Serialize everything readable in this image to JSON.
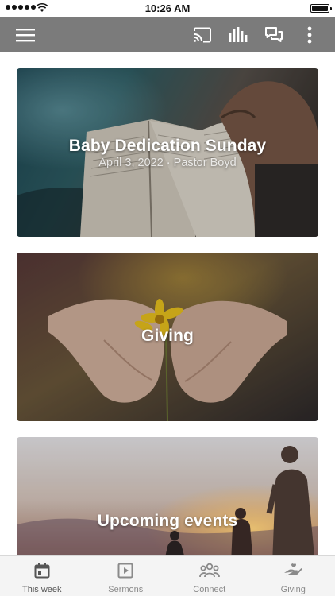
{
  "status_bar": {
    "time": "10:26 AM"
  },
  "toolbar": {
    "icons": [
      "menu-icon",
      "cast-icon",
      "audio-bars-icon",
      "chat-icon",
      "more-vertical-icon"
    ],
    "background": "#7b7b7b"
  },
  "feed": {
    "cards": [
      {
        "title": "Baby Dedication Sunday",
        "subtitle": "April 3, 2022 · Pastor Boyd",
        "image": "open-bible-photo"
      },
      {
        "title": "Giving",
        "image": "hands-holding-flower-photo"
      },
      {
        "title": "Upcoming events",
        "image": "sunset-silhouettes-photo"
      }
    ]
  },
  "tab_bar": {
    "active": "This week",
    "tabs": [
      {
        "label": "This week",
        "icon": "calendar-icon"
      },
      {
        "label": "Sermons",
        "icon": "play-icon"
      },
      {
        "label": "Connect",
        "icon": "people-icon"
      },
      {
        "label": "Giving",
        "icon": "hand-icon"
      }
    ]
  }
}
